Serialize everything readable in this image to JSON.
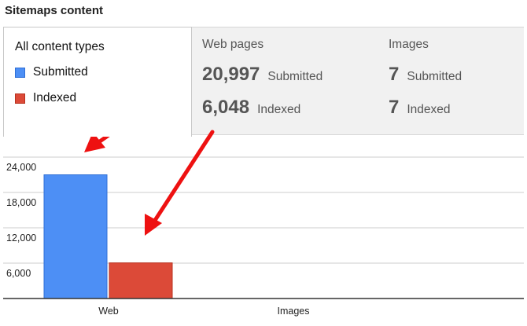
{
  "header": {
    "title": "Sitemaps content"
  },
  "legend": {
    "title": "All content types",
    "items": [
      {
        "label": "Submitted",
        "color": "#4d8ff5"
      },
      {
        "label": "Indexed",
        "color": "#dc4a38"
      }
    ]
  },
  "tabs": [
    {
      "label": "Web pages",
      "submitted_value": "20,997",
      "submitted_label": "Submitted",
      "indexed_value": "6,048",
      "indexed_label": "Indexed"
    },
    {
      "label": "Images",
      "submitted_value": "7",
      "submitted_label": "Submitted",
      "indexed_value": "7",
      "indexed_label": "Indexed"
    }
  ],
  "chart_data": {
    "type": "bar",
    "categories": [
      "Web",
      "Images"
    ],
    "series": [
      {
        "name": "Submitted",
        "values": [
          20997,
          7
        ]
      },
      {
        "name": "Indexed",
        "values": [
          6048,
          7
        ]
      }
    ],
    "ylim": [
      0,
      24000
    ],
    "yticks": [
      6000,
      12000,
      18000,
      24000
    ],
    "ytick_labels": [
      "6,000",
      "12,000",
      "18,000",
      "24,000"
    ],
    "grid": true,
    "colors": {
      "Submitted": "#4d8ff5",
      "Indexed": "#dc4a38",
      "arrows": "#ee1111"
    }
  }
}
